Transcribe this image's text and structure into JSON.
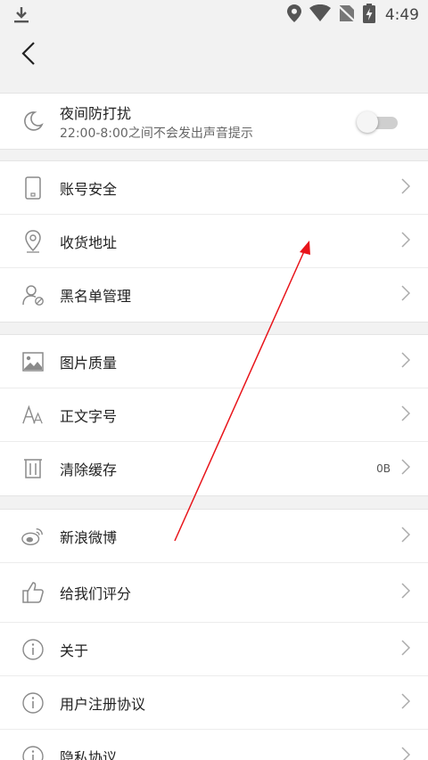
{
  "status_bar": {
    "time": "4:49",
    "icons": [
      "download-icon",
      "location-icon",
      "wifi-icon",
      "no-sim-icon",
      "battery-charging-icon"
    ]
  },
  "app_bar": {
    "back_icon": "chevron-left-icon"
  },
  "night_mode": {
    "title": "夜间防打扰",
    "subtitle": "22:00-8:00之间不会发出声音提示",
    "enabled": false
  },
  "group1": [
    {
      "label": "账号安全",
      "icon": "phone-icon"
    },
    {
      "label": "收货地址",
      "icon": "location-pin-icon"
    },
    {
      "label": "黑名单管理",
      "icon": "user-block-icon"
    }
  ],
  "group2": [
    {
      "label": "图片质量",
      "icon": "image-icon"
    },
    {
      "label": "正文字号",
      "icon": "font-size-icon"
    },
    {
      "label": "清除缓存",
      "icon": "trash-icon",
      "value": "0B"
    }
  ],
  "group3": [
    {
      "label": "新浪微博",
      "icon": "weibo-icon"
    },
    {
      "label": "给我们评分",
      "icon": "thumbs-up-icon"
    },
    {
      "label": "关于",
      "icon": "info-icon"
    },
    {
      "label": "用户注册协议",
      "icon": "info-icon"
    },
    {
      "label": "隐私协议",
      "icon": "info-icon"
    }
  ],
  "colors": {
    "annotation_arrow": "#e8141a",
    "icon_gray": "#8a8a8a",
    "background": "#f2f2f2"
  }
}
